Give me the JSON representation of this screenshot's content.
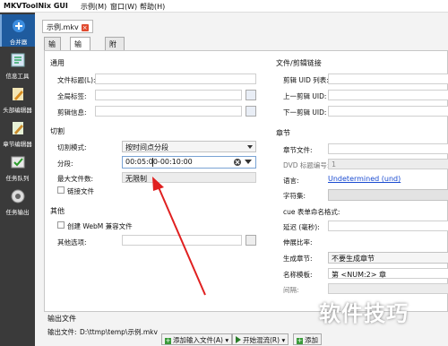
{
  "window": {
    "title": "MKVToolNix GUI",
    "menu": [
      "示例(M)",
      "窗口(W)",
      "帮助(H)"
    ]
  },
  "sidebar": {
    "items": [
      {
        "label": "合并器",
        "icon": "merge-icon",
        "active": true
      },
      {
        "label": "信息工具",
        "icon": "info-tool-icon"
      },
      {
        "label": "头部编辑器",
        "icon": "header-editor-icon"
      },
      {
        "label": "章节编辑器",
        "icon": "chapter-editor-icon"
      },
      {
        "label": "任务队列",
        "icon": "job-queue-icon"
      },
      {
        "label": "任务输出",
        "icon": "job-output-icon"
      }
    ]
  },
  "file_tab": {
    "label": "示例.mkv",
    "close": "×"
  },
  "tabs": [
    "输入(I)",
    "输出(O)",
    "附件(C)"
  ],
  "general": {
    "title": "通用",
    "file_title_label": "文件标题(L):",
    "global_tags_label": "全局标签:",
    "segment_info_label": "剪辑信息:"
  },
  "split": {
    "title": "切割",
    "mode_label": "切割模式:",
    "mode_value": "按时间点分段",
    "parts_label": "分段:",
    "parts_value": "00:05:00-00:10:00",
    "max_files_label": "最大文件数:",
    "max_files_value": "无限制",
    "link_files_label": "链接文件"
  },
  "misc": {
    "title": "其他",
    "webm_label": "创建 WebM 兼容文件",
    "other_options_label": "其他选项:"
  },
  "file_links": {
    "title": "文件/剪辑链接",
    "segment_uids_label": "剪辑 UID 列表:",
    "previous_uid_label": "上一剪辑 UID:",
    "next_uid_label": "下一剪辑 UID:"
  },
  "chapters": {
    "title": "章节",
    "chapter_file_label": "章节文件:",
    "dvd_title_label": "DVD 标题编号:",
    "dvd_title_value": "1",
    "language_label": "语言:",
    "language_value": "Undetermined (und)",
    "charset_label": "字符集:",
    "cue_name_label": "cue 表单命名格式:",
    "delay_label": "延迟 (毫秒):",
    "stretch_label": "伸展比率:",
    "generate_label": "生成章节:",
    "generate_value": "不要生成章节",
    "name_template_label": "名称模板:",
    "name_template_value": "第 <NUM:2> 章",
    "interval_label": "间隔:"
  },
  "output": {
    "title": "输出文件",
    "file_label": "输出文件:",
    "file_value": "D:\\ttmp\\temp\\示例.mkv"
  },
  "actions": {
    "add_input": "添加输入文件(A)",
    "start_mux": "开始混流(R)",
    "add_more": "添加"
  },
  "watermark": "软件技巧",
  "colors": {
    "accent": "#1f5b9e",
    "annotation_arrow": "#e02020",
    "sidebar_bg": "#3a3a3a"
  }
}
